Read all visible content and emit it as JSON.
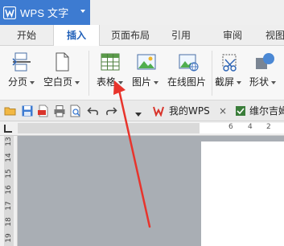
{
  "app": {
    "name": "WPS 文字"
  },
  "tabs": [
    "开始",
    "插入",
    "页面布局",
    "引用",
    "审阅",
    "视图"
  ],
  "active_tab": "插入",
  "ribbon": {
    "page_break": "分页",
    "blank_page": "空白页",
    "table": "表格",
    "picture": "图片",
    "online_picture": "在线图片",
    "screenshot": "截屏",
    "shapes": "形状"
  },
  "doc_tabs": {
    "my_wps": "我的WPS",
    "close": "×",
    "document": "维尔吉姆"
  },
  "ruler": {
    "h_ticks": [
      "6",
      "4",
      "2"
    ],
    "v_ticks": [
      "13",
      "14",
      "15",
      "16",
      "17",
      "18",
      "19"
    ]
  },
  "colors": {
    "app_button": "#3d7bd1",
    "active_tab_text": "#1f5fb8",
    "annotation_arrow": "#e8342c",
    "workspace": "#a9aeb4"
  }
}
